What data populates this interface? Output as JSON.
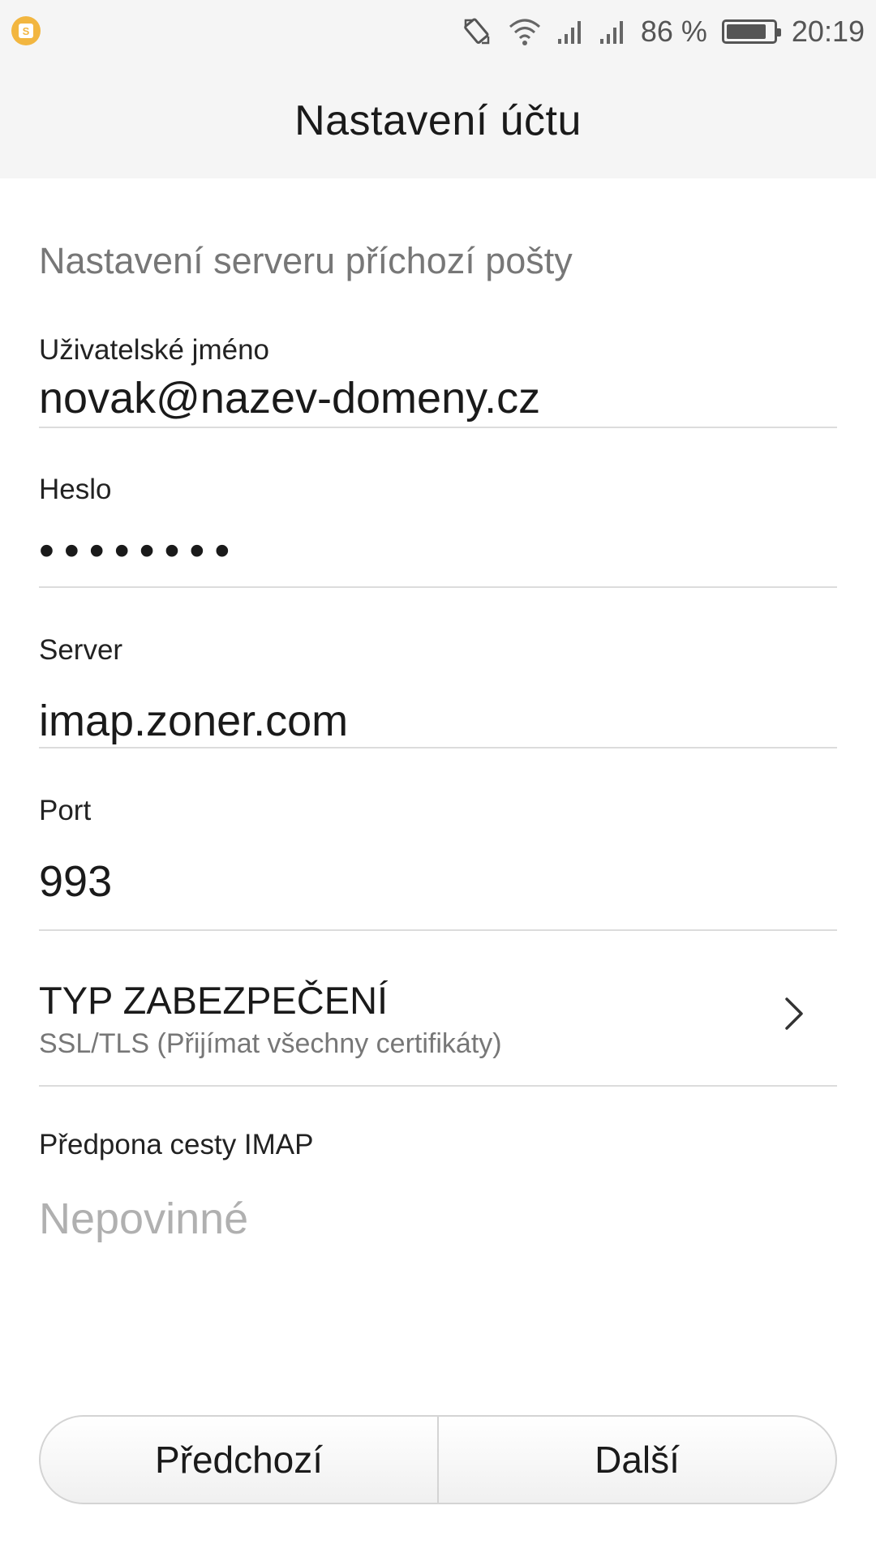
{
  "status_bar": {
    "battery_percent_label": "86 %",
    "battery_level": 0.86,
    "time": "20:19",
    "icons": [
      "notification-app-icon",
      "rotate-icon",
      "wifi-icon",
      "signal-icon",
      "signal-icon",
      "battery-icon"
    ]
  },
  "header": {
    "title": "Nastavení účtu"
  },
  "section": {
    "title": "Nastavení serveru příchozí pošty"
  },
  "fields": {
    "username": {
      "label": "Uživatelské jméno",
      "value": "novak@nazev-domeny.cz"
    },
    "password": {
      "label": "Heslo",
      "value": "••••••••"
    },
    "server": {
      "label": "Server",
      "value": "imap.zoner.com"
    },
    "port": {
      "label": "Port",
      "value": "993"
    },
    "imap_prefix": {
      "label": "Předpona cesty IMAP",
      "value": "",
      "placeholder": "Nepovinné"
    }
  },
  "security": {
    "title": "TYP ZABEZPEČENÍ",
    "value": "SSL/TLS (Přijímat všechny certifikáty)"
  },
  "buttons": {
    "previous": "Předchozí",
    "next": "Další"
  }
}
